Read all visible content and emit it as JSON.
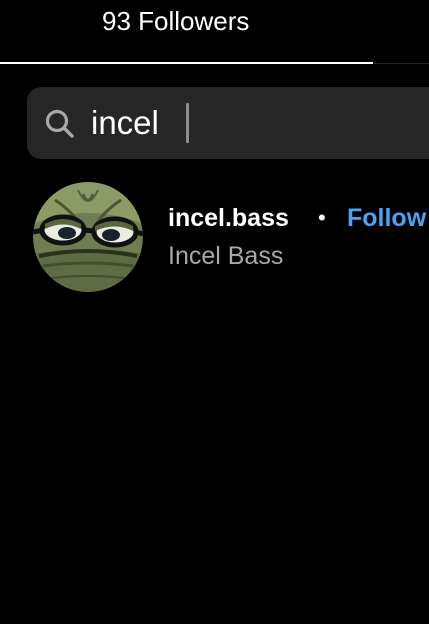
{
  "header": {
    "tab_label": "93 Followers"
  },
  "search": {
    "value": "incel",
    "icon": "search-icon"
  },
  "results": [
    {
      "username": "incel.bass",
      "separator": "•",
      "action_label": "Follow",
      "full_name": "Incel Bass",
      "avatar_icon": "avatar-image"
    }
  ],
  "colors": {
    "background": "#000000",
    "search_field": "#262626",
    "follow_link": "#4aa3f5",
    "secondary_text": "#a8a8a8"
  }
}
